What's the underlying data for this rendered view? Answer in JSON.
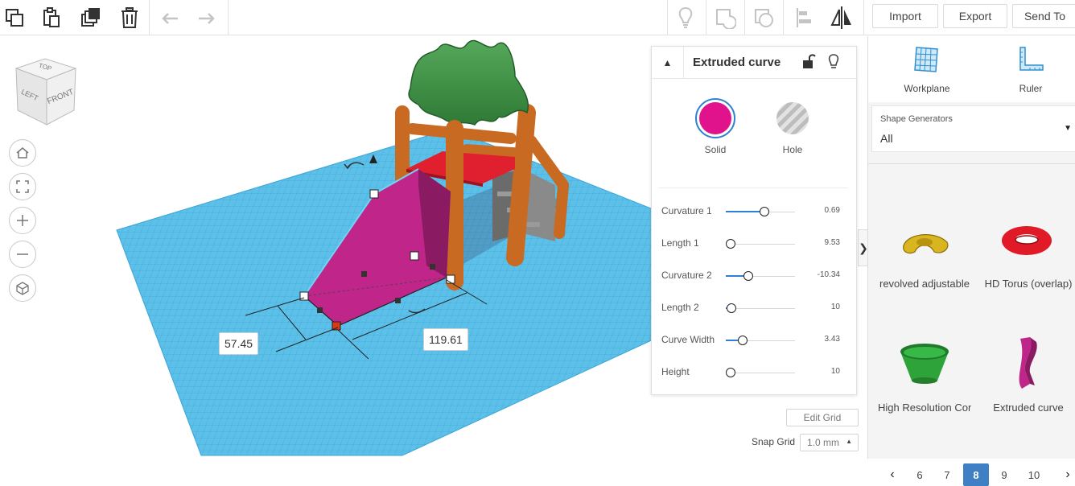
{
  "toolbar": {
    "import_label": "Import",
    "export_label": "Export",
    "send_to_label": "Send To"
  },
  "viewcube": {
    "top": "TOP",
    "left": "LEFT",
    "front": "FRONT"
  },
  "dimensions": {
    "width_value": "57.45",
    "length_value": "119.61"
  },
  "inspector": {
    "title": "Extruded curve",
    "solid_label": "Solid",
    "hole_label": "Hole",
    "solid_color": "#e0138c",
    "params": [
      {
        "label": "Curvature 1",
        "value": "0.69",
        "level": 0.49
      },
      {
        "label": "Length 1",
        "value": "9.53",
        "level": 0.0
      },
      {
        "label": "Curvature 2",
        "value": "-10.34",
        "level": 0.25
      },
      {
        "label": "Length 2",
        "value": "10",
        "level": 0.01
      },
      {
        "label": "Curve Width",
        "value": "3.43",
        "level": 0.17
      },
      {
        "label": "Height",
        "value": "10",
        "level": 0.0
      }
    ]
  },
  "grid": {
    "edit_label": "Edit Grid",
    "snap_label": "Snap Grid",
    "snap_value": "1.0 mm"
  },
  "right_panel": {
    "workplane_label": "Workplane",
    "ruler_label": "Ruler",
    "generators_caption": "Shape Generators",
    "generators_value": "All",
    "shapes": [
      {
        "label": "revolved adjustable"
      },
      {
        "label": "HD Torus (overlap)"
      },
      {
        "label": "High Resolution Cone"
      },
      {
        "label": "Extruded curve"
      }
    ],
    "pages": [
      "6",
      "7",
      "8",
      "9",
      "10"
    ],
    "current_page": "8"
  },
  "colors": {
    "accent": "#2f7fd2",
    "grid_blue": "#5cc0e8",
    "slide_magenta": "#c0258a",
    "wood": "#c86a22",
    "platform_red": "#e0202e",
    "leaves_green": "#3b8f3e"
  }
}
